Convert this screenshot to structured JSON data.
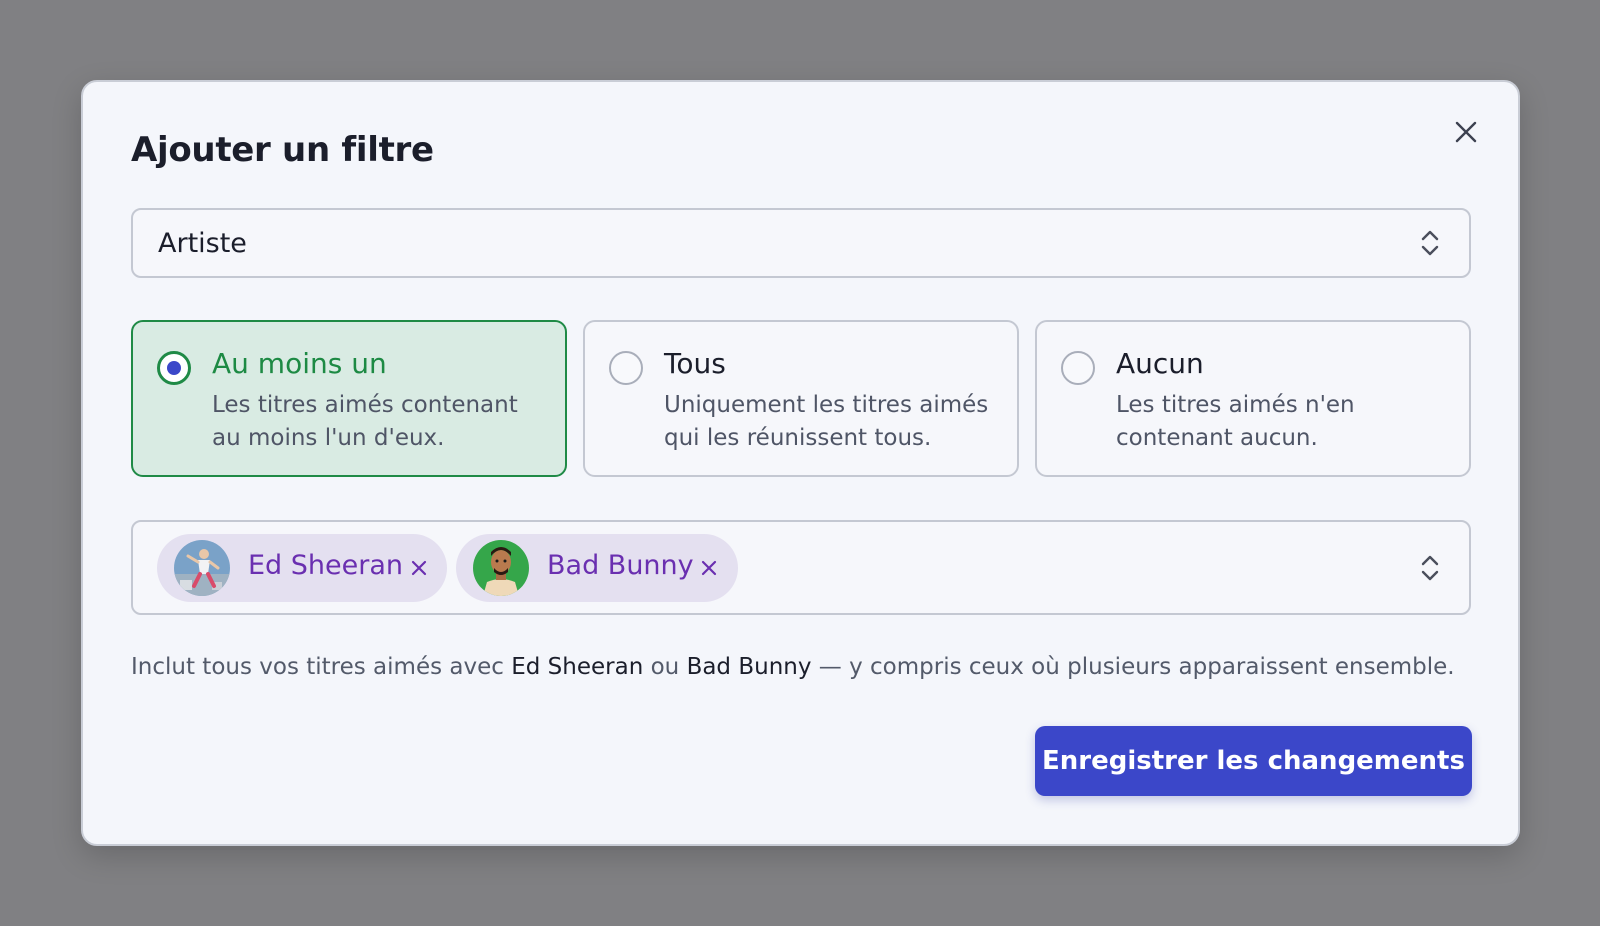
{
  "dialog": {
    "title": "Ajouter un filtre",
    "close_icon": "close-icon"
  },
  "field_select": {
    "value": "Artiste",
    "icon": "chevron-up-down-icon"
  },
  "match_options": [
    {
      "label": "Au moins un",
      "description": "Les titres aimés contenant au moins l'un d'eux.",
      "selected": true
    },
    {
      "label": "Tous",
      "description": "Uniquement les titres aimés qui les réunissent tous.",
      "selected": false
    },
    {
      "label": "Aucun",
      "description": "Les titres aimés n'en contenant aucun.",
      "selected": false
    }
  ],
  "selected_artists": [
    {
      "name": "Ed Sheeran",
      "remove_icon": "close-icon"
    },
    {
      "name": "Bad Bunny",
      "remove_icon": "close-icon"
    }
  ],
  "help": {
    "prefix": "Inclut tous vos titres aimés avec ",
    "artist1": "Ed Sheeran",
    "middle": " ou ",
    "artist2": "Bad Bunny",
    "suffix": " — y compris ceux où plusieurs apparaissent ensemble."
  },
  "save_button": {
    "label": "Enregistrer les changements"
  },
  "colors": {
    "accent": "#3b47c9",
    "selected_border": "#1f8a46",
    "selected_bg": "#d9ebe3",
    "chip_bg": "#e4e0f0",
    "chip_text": "#6a2fb0",
    "backdrop": "#808083"
  }
}
